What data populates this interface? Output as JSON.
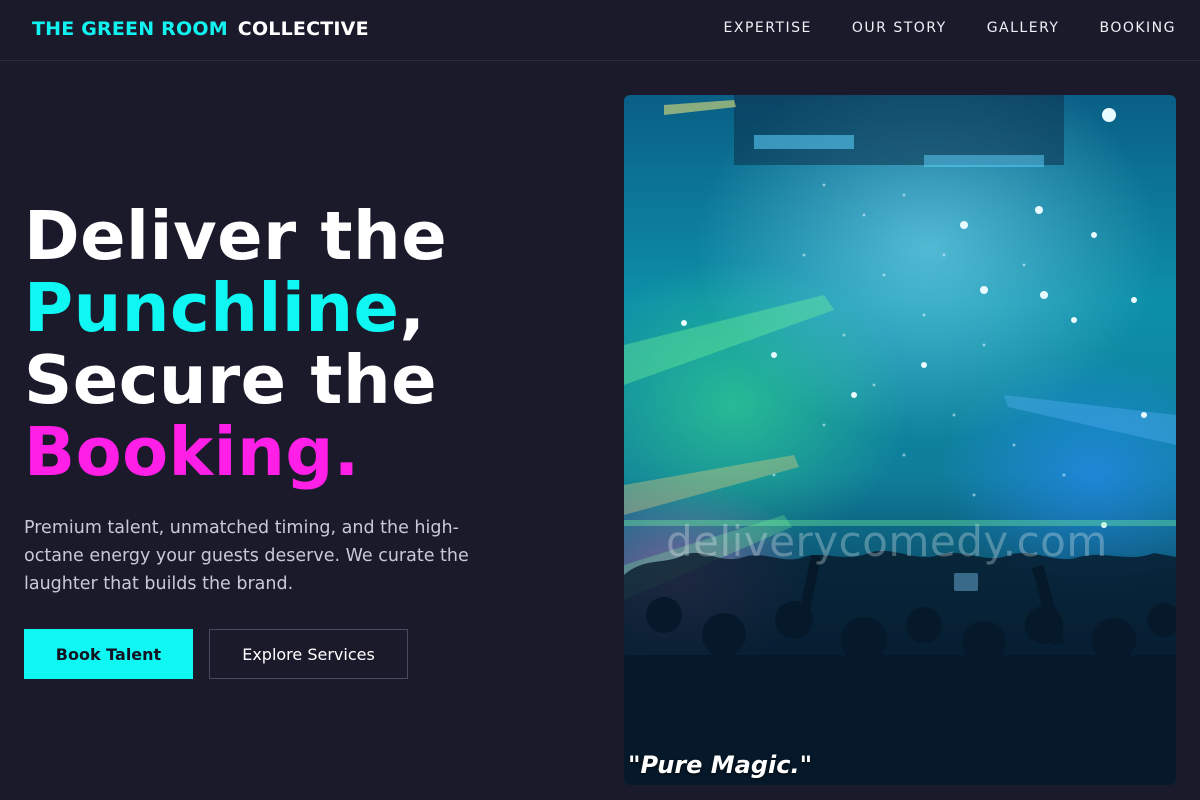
{
  "header": {
    "logo_accent": "THE GREEN ROOM",
    "logo_rest": "COLLECTIVE",
    "nav": [
      "EXPERTISE",
      "OUR STORY",
      "GALLERY",
      "BOOKING"
    ]
  },
  "hero": {
    "headline": {
      "line1": "Deliver the",
      "line2_accent": "Punchline",
      "line2_rest": ",",
      "line3": "Secure the",
      "line4_accent": "Booking."
    },
    "lede": "Premium talent, unmatched timing, and the high-octane energy your guests deserve. We curate the laughter that builds the brand.",
    "primary_button": "Book Talent",
    "secondary_button": "Explore Services"
  },
  "photo": {
    "watermark": "deliverycomedy.com",
    "caption": "\"Pure Magic.\""
  },
  "colors": {
    "background": "#1b1a2b",
    "accent_cyan": "#0ff7f3",
    "accent_magenta": "#ff1fe6"
  }
}
